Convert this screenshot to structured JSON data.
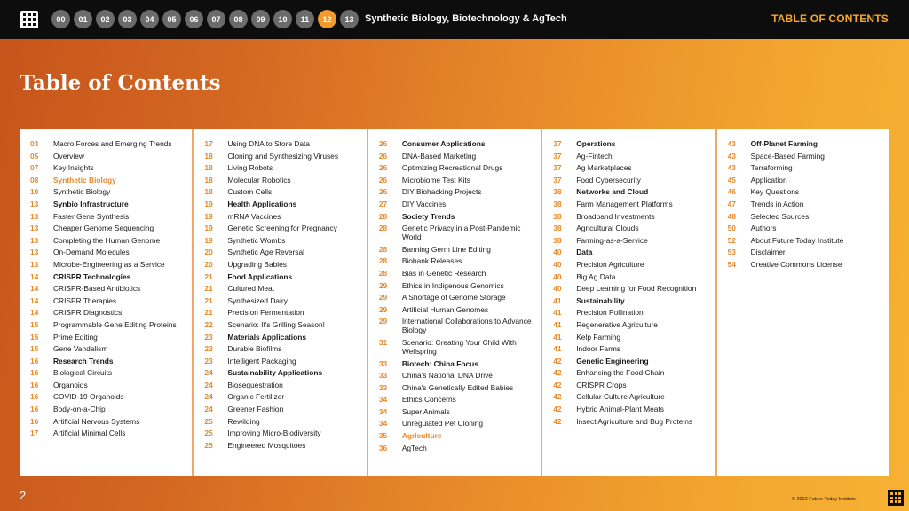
{
  "header": {
    "chapters": [
      "00",
      "01",
      "02",
      "03",
      "04",
      "05",
      "06",
      "07",
      "08",
      "09",
      "10",
      "11",
      "12",
      "13"
    ],
    "active_chapter": "12",
    "title": "Synthetic Biology, Biotechnology & AgTech",
    "section": "TABLE OF CONTENTS"
  },
  "page_title": "Table of Contents",
  "columns": [
    [
      {
        "num": "03",
        "label": "Macro Forces and Emerging Trends",
        "style": "normal"
      },
      {
        "num": "05",
        "label": "Overview",
        "style": "normal"
      },
      {
        "num": "07",
        "label": "Key Insights",
        "style": "normal"
      },
      {
        "num": "08",
        "label": "Synthetic Biology",
        "style": "highlight"
      },
      {
        "num": "10",
        "label": "Synthetic Biology",
        "style": "normal"
      },
      {
        "num": "13",
        "label": "Synbio Infrastructure",
        "style": "bold"
      },
      {
        "num": "13",
        "label": "Faster Gene Synthesis",
        "style": "normal"
      },
      {
        "num": "13",
        "label": "Cheaper Genome Sequencing",
        "style": "normal"
      },
      {
        "num": "13",
        "label": "Completing the Human Genome",
        "style": "normal"
      },
      {
        "num": "13",
        "label": "On-Demand Molecules",
        "style": "normal"
      },
      {
        "num": "13",
        "label": "Microbe-Engineering as a Service",
        "style": "normal"
      },
      {
        "num": "14",
        "label": "CRISPR Technologies",
        "style": "bold"
      },
      {
        "num": "14",
        "label": "CRISPR-Based Antibiotics",
        "style": "normal"
      },
      {
        "num": "14",
        "label": "CRISPR Therapies",
        "style": "normal"
      },
      {
        "num": "14",
        "label": "CRISPR Diagnostics",
        "style": "normal"
      },
      {
        "num": "15",
        "label": "Programmable Gene Editing Proteins",
        "style": "normal"
      },
      {
        "num": "15",
        "label": "Prime Editing",
        "style": "normal"
      },
      {
        "num": "15",
        "label": "Gene Vandalism",
        "style": "normal"
      },
      {
        "num": "16",
        "label": "Research Trends",
        "style": "bold"
      },
      {
        "num": "16",
        "label": "Biological Circuits",
        "style": "normal"
      },
      {
        "num": "16",
        "label": "Organoids",
        "style": "normal"
      },
      {
        "num": "16",
        "label": "COVID-19 Organoids",
        "style": "normal"
      },
      {
        "num": "16",
        "label": "Body-on-a-Chip",
        "style": "normal"
      },
      {
        "num": "16",
        "label": "Artificial Nervous Systems",
        "style": "normal"
      },
      {
        "num": "17",
        "label": "Artificial Minimal Cells",
        "style": "normal"
      }
    ],
    [
      {
        "num": "17",
        "label": "Using DNA to Store Data",
        "style": "normal"
      },
      {
        "num": "18",
        "label": "Cloning and Synthesizing Viruses",
        "style": "normal"
      },
      {
        "num": "18",
        "label": "Living Robots",
        "style": "normal"
      },
      {
        "num": "18",
        "label": "Molecular Robotics",
        "style": "normal"
      },
      {
        "num": "18",
        "label": "Custom Cells",
        "style": "normal"
      },
      {
        "num": "19",
        "label": "Health Applications",
        "style": "bold"
      },
      {
        "num": "19",
        "label": "mRNA Vaccines",
        "style": "normal"
      },
      {
        "num": "19",
        "label": "Genetic Screening for Pregnancy",
        "style": "normal"
      },
      {
        "num": "19",
        "label": "Synthetic Wombs",
        "style": "normal"
      },
      {
        "num": "20",
        "label": "Synthetic Age Reversal",
        "style": "normal"
      },
      {
        "num": "20",
        "label": "Upgrading Babies",
        "style": "normal"
      },
      {
        "num": "21",
        "label": "Food Applications",
        "style": "bold"
      },
      {
        "num": "21",
        "label": "Cultured Meat",
        "style": "normal"
      },
      {
        "num": "21",
        "label": "Synthesized Dairy",
        "style": "normal"
      },
      {
        "num": "21",
        "label": "Precision Fermentation",
        "style": "normal"
      },
      {
        "num": "22",
        "label": "Scenario: It's Grilling Season!",
        "style": "normal"
      },
      {
        "num": "23",
        "label": "Materials Applications",
        "style": "bold"
      },
      {
        "num": "23",
        "label": "Durable Biofilms",
        "style": "normal"
      },
      {
        "num": "23",
        "label": "Intelligent Packaging",
        "style": "normal"
      },
      {
        "num": "24",
        "label": "Sustainability Applications",
        "style": "bold"
      },
      {
        "num": "24",
        "label": "Biosequestration",
        "style": "normal"
      },
      {
        "num": "24",
        "label": "Organic Fertilizer",
        "style": "normal"
      },
      {
        "num": "24",
        "label": "Greener Fashion",
        "style": "normal"
      },
      {
        "num": "25",
        "label": "Rewilding",
        "style": "normal"
      },
      {
        "num": "25",
        "label": "Improving Micro-Biodiversity",
        "style": "normal"
      },
      {
        "num": "25",
        "label": "Engineered Mosquitoes",
        "style": "normal"
      }
    ],
    [
      {
        "num": "26",
        "label": "Consumer Applications",
        "style": "bold"
      },
      {
        "num": "26",
        "label": "DNA-Based Marketing",
        "style": "normal"
      },
      {
        "num": "26",
        "label": "Optimizing Recreational Drugs",
        "style": "normal"
      },
      {
        "num": "26",
        "label": "Microbiome Test Kits",
        "style": "normal"
      },
      {
        "num": "26",
        "label": "DIY Biohacking Projects",
        "style": "normal"
      },
      {
        "num": "27",
        "label": "DIY Vaccines",
        "style": "normal"
      },
      {
        "num": "28",
        "label": "Society Trends",
        "style": "bold"
      },
      {
        "num": "28",
        "label": "Genetic Privacy in a Post-Pandemic World",
        "style": "normal"
      },
      {
        "num": "28",
        "label": "Banning Germ Line Editing",
        "style": "normal"
      },
      {
        "num": "28",
        "label": "Biobank Releases",
        "style": "normal"
      },
      {
        "num": "28",
        "label": "Bias in Genetic Research",
        "style": "normal"
      },
      {
        "num": "29",
        "label": "Ethics in Indigenous Genomics",
        "style": "normal"
      },
      {
        "num": "29",
        "label": "A Shortage of Genome Storage",
        "style": "normal"
      },
      {
        "num": "29",
        "label": "Artificial Human Genomes",
        "style": "normal"
      },
      {
        "num": "29",
        "label": "International Collaborations to Advance Biology",
        "style": "normal"
      },
      {
        "num": "31",
        "label": "Scenario: Creating Your Child With Wellspring",
        "style": "normal"
      },
      {
        "num": "33",
        "label": "Biotech: China Focus",
        "style": "bold"
      },
      {
        "num": "33",
        "label": "China's National DNA Drive",
        "style": "normal"
      },
      {
        "num": "33",
        "label": "China's Genetically Edited Babies",
        "style": "normal"
      },
      {
        "num": "34",
        "label": "Ethics Concerns",
        "style": "normal"
      },
      {
        "num": "34",
        "label": "Super Animals",
        "style": "normal"
      },
      {
        "num": "34",
        "label": "Unregulated Pet Cloning",
        "style": "normal"
      },
      {
        "num": "35",
        "label": "Agriculture",
        "style": "highlight"
      },
      {
        "num": "36",
        "label": "AgTech",
        "style": "normal"
      }
    ],
    [
      {
        "num": "37",
        "label": "Operations",
        "style": "bold"
      },
      {
        "num": "37",
        "label": "Ag-Fintech",
        "style": "normal"
      },
      {
        "num": "37",
        "label": "Ag Marketplaces",
        "style": "normal"
      },
      {
        "num": "37",
        "label": "Food Cybersecurity",
        "style": "normal"
      },
      {
        "num": "38",
        "label": "Networks and Cloud",
        "style": "bold"
      },
      {
        "num": "38",
        "label": "Farm Management Platforms",
        "style": "normal"
      },
      {
        "num": "38",
        "label": "Broadband Investments",
        "style": "normal"
      },
      {
        "num": "38",
        "label": "Agricultural Clouds",
        "style": "normal"
      },
      {
        "num": "38",
        "label": "Farming-as-a-Service",
        "style": "normal"
      },
      {
        "num": "40",
        "label": "Data",
        "style": "bold"
      },
      {
        "num": "40",
        "label": "Precision Agriculture",
        "style": "normal"
      },
      {
        "num": "40",
        "label": "Big Ag Data",
        "style": "normal"
      },
      {
        "num": "40",
        "label": "Deep Learning for Food Recognition",
        "style": "normal"
      },
      {
        "num": "41",
        "label": "Sustainability",
        "style": "bold"
      },
      {
        "num": "41",
        "label": "Precision Pollination",
        "style": "normal"
      },
      {
        "num": "41",
        "label": "Regenerative Agriculture",
        "style": "normal"
      },
      {
        "num": "41",
        "label": "Kelp Farming",
        "style": "normal"
      },
      {
        "num": "41",
        "label": "Indoor Farms",
        "style": "normal"
      },
      {
        "num": "42",
        "label": "Genetic Engineering",
        "style": "bold"
      },
      {
        "num": "42",
        "label": "Enhancing the Food Chain",
        "style": "normal"
      },
      {
        "num": "42",
        "label": "CRISPR Crops",
        "style": "normal"
      },
      {
        "num": "42",
        "label": "Cellular Culture Agriculture",
        "style": "normal"
      },
      {
        "num": "42",
        "label": "Hybrid Animal-Plant Meats",
        "style": "normal"
      },
      {
        "num": "42",
        "label": "Insect Agriculture and Bug Proteins",
        "style": "normal"
      }
    ],
    [
      {
        "num": "43",
        "label": "Off-Planet Farming",
        "style": "bold"
      },
      {
        "num": "43",
        "label": "Space-Based Farming",
        "style": "normal"
      },
      {
        "num": "43",
        "label": "Terraforming",
        "style": "normal"
      },
      {
        "num": "45",
        "label": "Application",
        "style": "normal"
      },
      {
        "num": "46",
        "label": "Key Questions",
        "style": "normal"
      },
      {
        "num": "47",
        "label": "Trends in Action",
        "style": "normal"
      },
      {
        "num": "48",
        "label": "Selected Sources",
        "style": "normal"
      },
      {
        "num": "50",
        "label": "Authors",
        "style": "normal"
      },
      {
        "num": "52",
        "label": "About Future Today Institute",
        "style": "normal"
      },
      {
        "num": "53",
        "label": "Disclaimer",
        "style": "normal"
      },
      {
        "num": "54",
        "label": "Creative Commons License",
        "style": "normal"
      }
    ]
  ],
  "footer": {
    "page_number": "2",
    "copyright": "© 2022 Future Today Institute"
  },
  "colors": {
    "accent": "#e8892a",
    "active_chip": "#f29a2e",
    "topbar": "#0d0d0d"
  }
}
